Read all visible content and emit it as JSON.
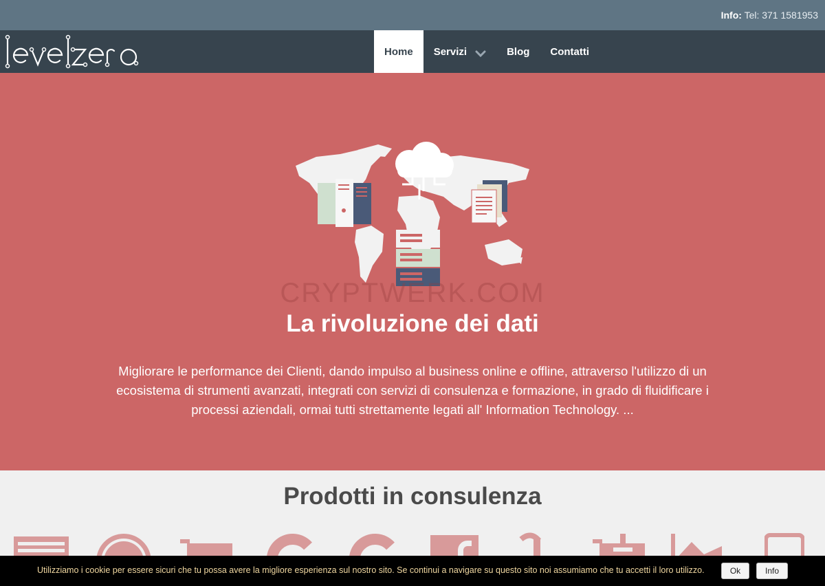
{
  "topbar": {
    "info_label": "Info:",
    "info_value": "Tel: 371 1581953"
  },
  "brand": {
    "logo_text": "levelzero"
  },
  "nav": {
    "items": [
      {
        "label": "Home",
        "active": true
      },
      {
        "label": "Servizi",
        "has_dropdown": true
      },
      {
        "label": "Blog"
      },
      {
        "label": "Contatti"
      }
    ]
  },
  "hero": {
    "watermark": "CRYPTWERK.COM",
    "title": "La rivoluzione dei dati",
    "text": "Migliorare le performance dei Clienti, dando impulso al business online e offline, attraverso l'utilizzo di un ecosistema di strumenti avanzati, integrati con servizi di consulenza e formazione, in grado di fluidificare i processi aziendali, ormai tutti strettamente legati all' Information Technology. ...",
    "bg_color": "#cc6666"
  },
  "products": {
    "title": "Prodotti in consulenza",
    "icons": [
      "website-icon",
      "wordpress-icon",
      "cart-icon",
      "google-icon",
      "google-plus-icon",
      "facebook-icon",
      "amazon-icon",
      "cart-add-icon",
      "analytics-icon",
      "tablet-icon"
    ]
  },
  "cookie": {
    "message": "Utilizziamo i cookie per essere sicuri che tu possa avere la migliore esperienza sul nostro sito. Se continui a navigare su questo sito noi assumiamo che tu accetti il loro utilizzo.",
    "ok_label": "Ok",
    "info_label": "Info"
  },
  "colors": {
    "topbar": "#5f7584",
    "navbar": "#37444e",
    "hero": "#cc6666",
    "icon_muted": "#d89a9a"
  }
}
